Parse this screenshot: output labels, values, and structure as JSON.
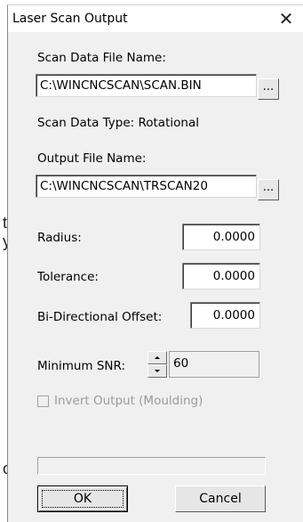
{
  "dialog": {
    "title": "Laser Scan Output",
    "close_glyph": "✕"
  },
  "background": {
    "edge_chars": [
      "t",
      "y",
      "o"
    ]
  },
  "scan_data_file": {
    "label": "Scan Data File Name:",
    "value": "C:\\WINCNCSCAN\\SCAN.BIN",
    "browse_label": "..."
  },
  "scan_data_type": {
    "label": "Scan Data Type: Rotational"
  },
  "output_file": {
    "label": "Output File Name:",
    "value": "C:\\WINCNCSCAN\\TRSCAN20",
    "browse_label": "..."
  },
  "radius": {
    "label": "Radius:",
    "value": "0.0000"
  },
  "tolerance": {
    "label": "Tolerance:",
    "value": "0.0000"
  },
  "bidir_offset": {
    "label": "Bi-Directional Offset:",
    "value": "0.0000"
  },
  "min_snr": {
    "label": "Minimum SNR:",
    "value": "60"
  },
  "invert_output": {
    "label": "Invert Output (Moulding)",
    "checked": false,
    "enabled": false
  },
  "progress": {
    "fraction": 0
  },
  "buttons": {
    "ok_label": "OK",
    "cancel_label": "Cancel"
  },
  "icons": {
    "close": "close-icon",
    "spin_up": "chevron-up-icon",
    "spin_down": "chevron-down-icon"
  }
}
